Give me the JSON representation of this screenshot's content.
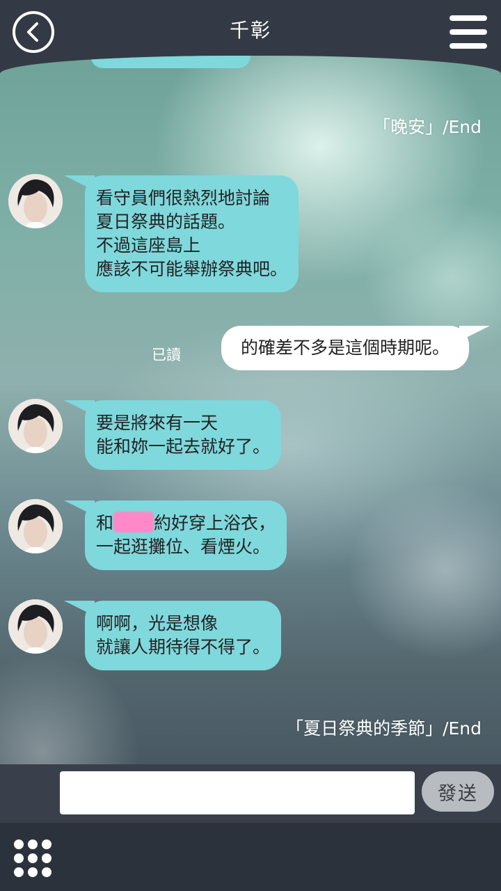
{
  "header": {
    "title": "千彰",
    "back_icon": "chevron-left-icon",
    "menu_icon": "hamburger-menu-icon"
  },
  "chat": {
    "end_labels": [
      "「晚安」/End",
      "「夏日祭典的季節」/End"
    ],
    "messages": [
      {
        "from": "other",
        "text": "看守員們很熱烈地討論\n夏日祭典的話題。\n不過這座島上\n應該不可能舉辦祭典吧。"
      },
      {
        "from": "me",
        "read": "已讀",
        "text": "的確差不多是這個時期呢。"
      },
      {
        "from": "other",
        "text": "要是將來有一天\n能和妳一起去就好了。"
      },
      {
        "from": "other",
        "text_before": "和",
        "text_after": "約好穿上浴衣，\n一起逛攤位、看煙火。",
        "redacted_color": "#ff88c8"
      },
      {
        "from": "other",
        "text": "啊啊，光是想像\n就讓人期待得不得了。"
      }
    ]
  },
  "composer": {
    "input_value": "",
    "send_label": "發送"
  },
  "footer": {
    "grid_icon": "grid-menu-icon"
  },
  "colors": {
    "bubble_other": "#7fd8dc",
    "bubble_me": "#ffffff",
    "topbar": "#343a45"
  }
}
